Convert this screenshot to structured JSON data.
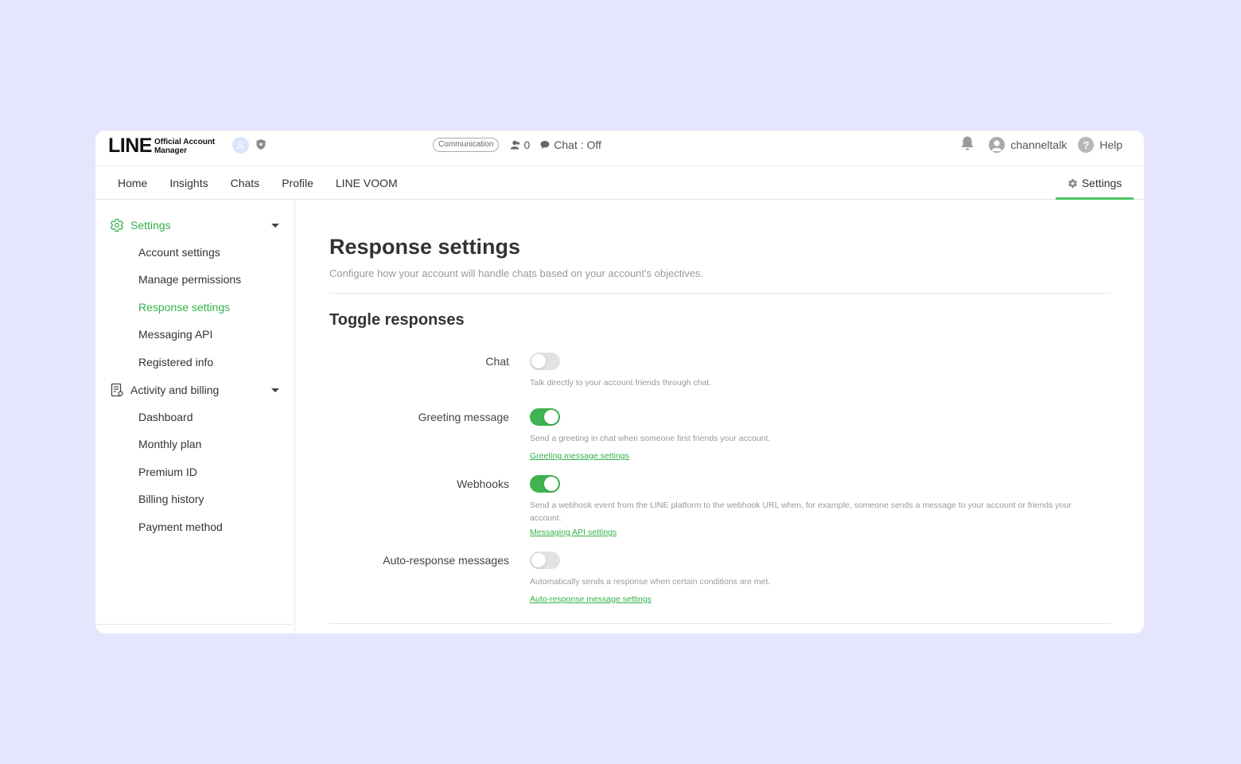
{
  "header": {
    "logo_main": "LINE",
    "logo_sub_1": "Official Account",
    "logo_sub_2": "Manager",
    "badge": "Communication",
    "friends_count": "0",
    "chat_status": "Chat : Off",
    "username": "channeltalk",
    "help": "Help"
  },
  "nav": {
    "items": [
      "Home",
      "Insights",
      "Chats",
      "Profile",
      "LINE VOOM"
    ],
    "settings": "Settings"
  },
  "sidebar": {
    "group1": {
      "label": "Settings",
      "items": [
        "Account settings",
        "Manage permissions",
        "Response settings",
        "Messaging API",
        "Registered info"
      ]
    },
    "group2": {
      "label": "Activity and billing",
      "items": [
        "Dashboard",
        "Monthly plan",
        "Premium ID",
        "Billing history",
        "Payment method"
      ]
    }
  },
  "main": {
    "title": "Response settings",
    "description": "Configure how your account will handle chats based on your account's objectives.",
    "section_title": "Toggle responses",
    "rows": [
      {
        "label": "Chat",
        "enabled": false,
        "description": "Talk directly to your account friends through chat.",
        "link": ""
      },
      {
        "label": "Greeting message",
        "enabled": true,
        "description": "Send a greeting in chat when someone first friends your account.",
        "link": "Greeting message settings"
      },
      {
        "label": "Webhooks",
        "enabled": true,
        "description": "Send a webhook event from the LINE platform to the webhook URL when, for example, someone sends a message to your account or friends your account.",
        "link": "Messaging API settings"
      },
      {
        "label": "Auto-response messages",
        "enabled": false,
        "description": "Automatically sends a response when certain conditions are met.",
        "link": "Auto-response message settings"
      }
    ]
  },
  "colors": {
    "accent": "#4cc764",
    "toggle_on": "#3fb34f",
    "background": "#e5e6fd"
  }
}
